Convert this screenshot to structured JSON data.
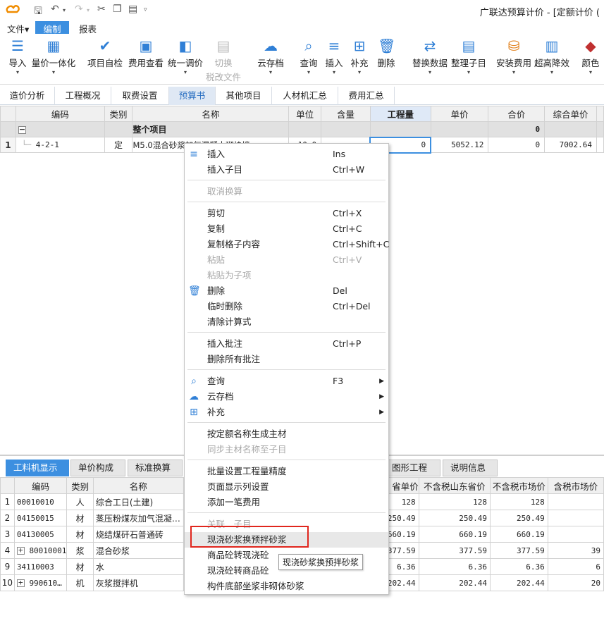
{
  "app": {
    "title": "广联达预算计价 - [定额计价 ("
  },
  "menu": [
    "文件▾",
    "编制",
    "报表"
  ],
  "ribbon": [
    {
      "label": "导入",
      "icon": "import-icon"
    },
    {
      "label": "量价一体化",
      "icon": "quantity-price-icon"
    },
    {
      "label": "项目自检",
      "icon": "self-check-icon"
    },
    {
      "label": "费用查看",
      "icon": "fee-view-icon"
    },
    {
      "label": "统一调价",
      "icon": "price-adjust-icon"
    },
    {
      "label": "切换",
      "label2": "税改文件",
      "icon": "switch-tax-icon"
    },
    {
      "label": "云存档",
      "icon": "cloud-icon"
    },
    {
      "label": "查询",
      "icon": "query-icon"
    },
    {
      "label": "插入",
      "icon": "insert-icon"
    },
    {
      "label": "补充",
      "icon": "supplement-icon"
    },
    {
      "label": "删除",
      "icon": "delete-icon"
    },
    {
      "label": "替换数据",
      "icon": "replace-data-icon"
    },
    {
      "label": "整理子目",
      "icon": "organize-icon"
    },
    {
      "label": "安装费用",
      "icon": "install-fee-icon"
    },
    {
      "label": "超高降效",
      "icon": "super-high-icon"
    },
    {
      "label": "颜色",
      "icon": "color-icon"
    }
  ],
  "navtabs": [
    "造价分析",
    "工程概况",
    "取费设置",
    "预算书",
    "其他项目",
    "人材机汇总",
    "费用汇总"
  ],
  "grid": {
    "headers": [
      "编码",
      "类别",
      "名称",
      "单位",
      "含量",
      "工程量",
      "单价",
      "合价",
      "综合单价"
    ],
    "group": {
      "name": "整个项目",
      "total": "0"
    },
    "row": {
      "no": "1",
      "code": "4-2-1",
      "type": "定",
      "name": "M5.0混合砂浆加气混凝土砌块墙",
      "unit": "10.0",
      "qty": "0",
      "price": "5052.12",
      "total": "0",
      "unitprice": "7002.64"
    }
  },
  "bottom_tabs": [
    "工料机显示",
    "单价构成",
    "标准换算",
    "图形工程量",
    "说明信息"
  ],
  "btable": {
    "headers": [
      "编码",
      "类别",
      "名称",
      "省单价",
      "不含税山东省价",
      "不含税市场价",
      "含税市场价"
    ],
    "rows": [
      {
        "no": "1",
        "code": "00010010",
        "type": "人",
        "name": "综合工日(土建)",
        "v1": "128",
        "v2": "128",
        "v3": "128",
        "v4": ""
      },
      {
        "no": "2",
        "code": "04150015",
        "type": "材",
        "name": "蒸压粉煤灰加气混凝…",
        "v1": "250.49",
        "v2": "250.49",
        "v3": "250.49",
        "v4": ""
      },
      {
        "no": "3",
        "code": "04130005",
        "type": "材",
        "name": "烧结煤矸石普通砖",
        "v1": "660.19",
        "v2": "660.19",
        "v3": "660.19",
        "v4": ""
      },
      {
        "no": "4",
        "code": "80010001",
        "type": "浆",
        "name": "混合砂浆",
        "v1": "377.59",
        "v2": "377.59",
        "v3": "377.59",
        "v4": "39"
      },
      {
        "no": "9",
        "code": "34110003",
        "type": "材",
        "name": "水",
        "v1": "6.36",
        "v2": "6.36",
        "v3": "6.36",
        "v4": "6"
      },
      {
        "no": "10",
        "code": "990610…",
        "type": "机",
        "name": "灰浆搅拌机",
        "v1": "202.44",
        "v2": "202.44",
        "v3": "202.44",
        "v4": "20"
      }
    ]
  },
  "context_menu": [
    {
      "label": "插入",
      "key": "Ins",
      "icon": "insert-icon"
    },
    {
      "label": "插入子目",
      "key": "Ctrl+W"
    },
    {
      "label": "取消换算",
      "disabled": true
    },
    {
      "label": "剪切",
      "key": "Ctrl+X"
    },
    {
      "label": "复制",
      "key": "Ctrl+C"
    },
    {
      "label": "复制格子内容",
      "key": "Ctrl+Shift+C"
    },
    {
      "label": "粘贴",
      "key": "Ctrl+V",
      "disabled": true
    },
    {
      "label": "粘贴为子项",
      "disabled": true
    },
    {
      "label": "删除",
      "key": "Del",
      "icon": "delete-icon"
    },
    {
      "label": "临时删除",
      "key": "Ctrl+Del"
    },
    {
      "label": "清除计算式"
    },
    {
      "label": "插入批注",
      "key": "Ctrl+P"
    },
    {
      "label": "删除所有批注"
    },
    {
      "label": "查询",
      "key": "F3",
      "icon": "query-icon"
    },
    {
      "label": "云存档",
      "icon": "cloud-icon"
    },
    {
      "label": "补充",
      "icon": "supplement-icon"
    },
    {
      "label": "按定额名称生成主材"
    },
    {
      "label": "同步主材名称至子目",
      "disabled": true
    },
    {
      "label": "批量设置工程量精度"
    },
    {
      "label": "页面显示列设置"
    },
    {
      "label": "添加一笔费用"
    },
    {
      "label": "关联…子目",
      "disabled": true
    },
    {
      "label": "现浇砂浆换预拌砂浆"
    },
    {
      "label": "商品砼转现浇砼"
    },
    {
      "label": "现浇砼转商品砼"
    },
    {
      "label": "构件底部坐浆非砌体砂浆"
    }
  ],
  "tooltip": "现浇砂浆换预拌砂浆",
  "colors": {
    "accent": "#3c8fe0",
    "highlight": "#e0261d"
  }
}
